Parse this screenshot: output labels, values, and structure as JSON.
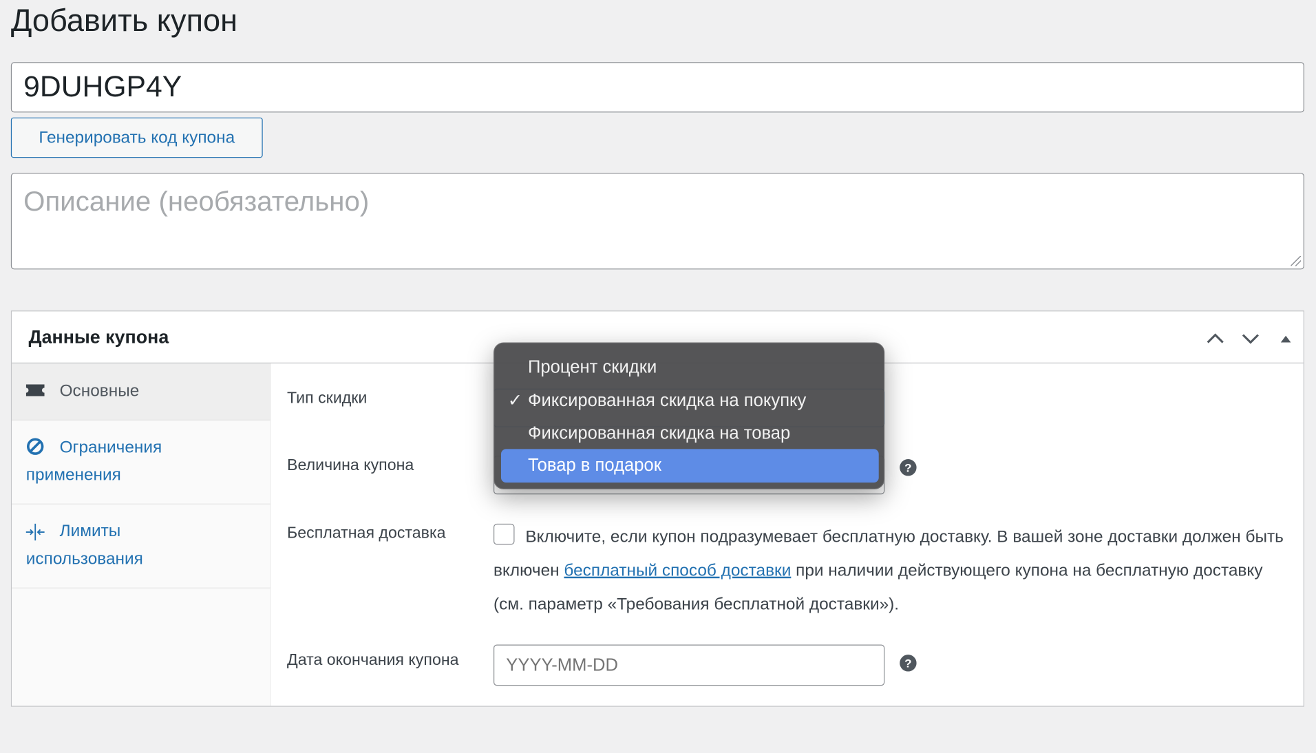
{
  "page": {
    "title": "Добавить купон"
  },
  "coupon_code": {
    "value": "9DUHGP4Y"
  },
  "generate_button": {
    "label": "Генерировать код купона"
  },
  "description": {
    "placeholder": "Описание (необязательно)"
  },
  "panel": {
    "title": "Данные купона",
    "controls": [
      "chevron-up-icon",
      "chevron-down-icon",
      "triangle-up-icon"
    ]
  },
  "sidebar": {
    "items": [
      {
        "label": "Основные",
        "icon": "ticket-icon",
        "active": true
      },
      {
        "label": "Ограничения применения",
        "line1": "Ограничения",
        "line2": "применения",
        "icon": "prohibited-icon",
        "active": false
      },
      {
        "label": "Лимиты использования",
        "line1": "Лимиты",
        "line2": "использования",
        "icon": "compress-arrows-icon",
        "active": false
      }
    ]
  },
  "fields": {
    "discount_type": {
      "label": "Тип скидки"
    },
    "amount": {
      "label": "Величина купона"
    },
    "free_shipping": {
      "label": "Бесплатная доставка",
      "text_before": "Включите, если купон подразумевает бесплатную доставку. В вашей зоне доставки должен быть включен ",
      "link": "бесплатный способ доставки",
      "text_after": " при наличии действующего купона на бесплатную доставку (см. параметр «Требования бесплатной доставки»).",
      "checked": false
    },
    "expiry_date": {
      "label": "Дата окончания купона",
      "placeholder": "YYYY-MM-DD"
    }
  },
  "dropdown": {
    "options": [
      {
        "label": "Процент скидки",
        "checked": false,
        "highlighted": false
      },
      {
        "label": "Фиксированная скидка на покупку",
        "checked": true,
        "highlighted": false
      },
      {
        "label": "Фиксированная скидка на товар",
        "checked": false,
        "highlighted": false
      },
      {
        "label": "Товар в подарок",
        "checked": false,
        "highlighted": true
      }
    ],
    "check_mark": "✓"
  },
  "colors": {
    "accent": "#2271b1",
    "highlight": "#5e8ce6",
    "background": "#f0f0f1"
  }
}
